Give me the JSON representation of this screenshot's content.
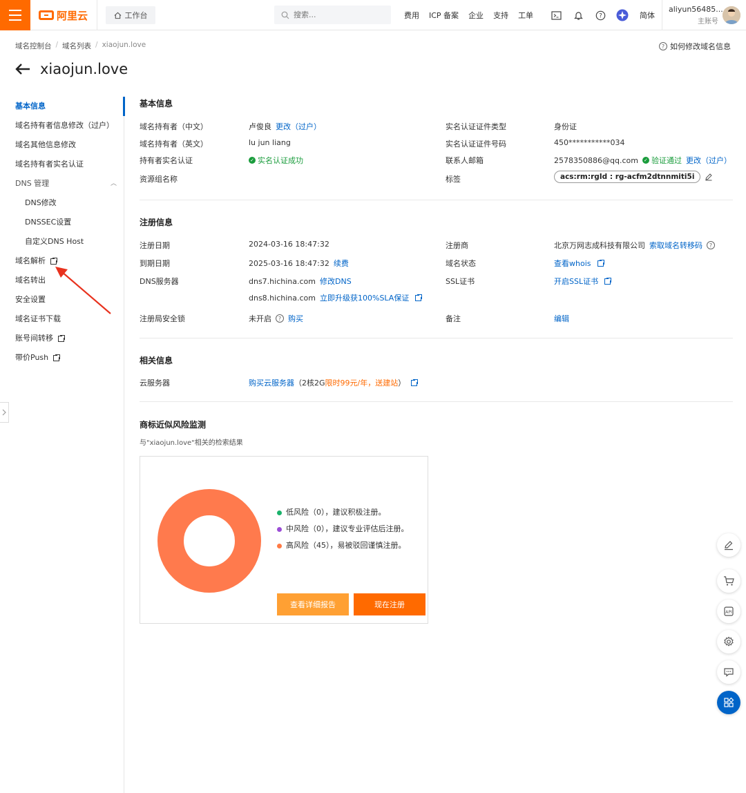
{
  "topbar": {
    "logo_text": "阿里云",
    "workbench": "工作台",
    "search_placeholder": "搜索...",
    "nav": [
      "费用",
      "ICP 备案",
      "企业",
      "支持",
      "工单"
    ],
    "lang": "简体",
    "account_name": "aliyun56485...",
    "account_role": "主账号"
  },
  "breadcrumb": [
    "域名控制台",
    "域名列表",
    "xiaojun.love"
  ],
  "help_link": "如何修改域名信息",
  "page_title": "xiaojun.love",
  "sidebar": {
    "items": [
      {
        "label": "基本信息"
      },
      {
        "label": "域名持有者信息修改（过户）"
      },
      {
        "label": "域名其他信息修改"
      },
      {
        "label": "域名持有者实名认证"
      },
      {
        "label": "DNS 管理"
      },
      {
        "label": "DNS修改"
      },
      {
        "label": "DNSSEC设置"
      },
      {
        "label": "自定义DNS Host"
      },
      {
        "label": "域名解析"
      },
      {
        "label": "域名转出"
      },
      {
        "label": "安全设置"
      },
      {
        "label": "域名证书下载"
      },
      {
        "label": "账号间转移"
      },
      {
        "label": "带价Push"
      }
    ]
  },
  "basic": {
    "title": "基本信息",
    "holder_cn_label": "域名持有者（中文）",
    "holder_cn_value": "卢俊良",
    "holder_cn_change": "更改（过户）",
    "holder_en_label": "域名持有者（英文）",
    "holder_en_value": "lu jun liang",
    "realname_label": "持有者实名认证",
    "realname_value": "实名认证成功",
    "resource_group_label": "资源组名称",
    "cert_type_label": "实名认证证件类型",
    "cert_type_value": "身份证",
    "cert_no_label": "实名认证证件号码",
    "cert_no_value": "450***********034",
    "email_label": "联系人邮箱",
    "email_value": "2578350886@qq.com",
    "email_verified": "验证通过",
    "email_change": "更改（过户）",
    "tag_label": "标签",
    "tag_value": "acs:rm:rgId : rg-acfm2dtnnmiti5i"
  },
  "registration": {
    "title": "注册信息",
    "reg_date_label": "注册日期",
    "reg_date_value": "2024-03-16 18:47:32",
    "exp_date_label": "到期日期",
    "exp_date_value": "2025-03-16 18:47:32",
    "renew": "续费",
    "dns_label": "DNS服务器",
    "dns1": "dns7.hichina.com",
    "dns_modify": "修改DNS",
    "dns2": "dns8.hichina.com",
    "dns_upgrade": "立即升级获100%SLA保证",
    "lock_label": "注册局安全锁",
    "lock_value": "未开启",
    "lock_buy": "购买",
    "registrar_label": "注册商",
    "registrar_value": "北京万网志成科技有限公司",
    "transfer_code": "索取域名转移码",
    "status_label": "域名状态",
    "status_link": "查看whois",
    "ssl_label": "SSL证书",
    "ssl_link": "开启SSL证书",
    "note_label": "备注",
    "note_edit": "编辑"
  },
  "related": {
    "title": "相关信息",
    "cloud_label": "云服务器",
    "cloud_link": "购买云服务器",
    "cloud_spec_prefix": "（2核2G",
    "cloud_promo": "限时99元/年，送建站",
    "cloud_spec_suffix": "）"
  },
  "trademark": {
    "title": "商标近似风险监测",
    "subtitle": "与\"xiaojun.love\"相关的检索结果",
    "legend": [
      {
        "text": "低风险（0），建议积极注册。",
        "color": "#1ab26b"
      },
      {
        "text": "中风险（0），建议专业评估后注册。",
        "color": "#9b4dd6"
      },
      {
        "text": "高风险（45），易被驳回谨慎注册。",
        "color": "#ff7a45"
      }
    ],
    "btn_report": "查看详细报告",
    "btn_register": "现在注册"
  },
  "chart_data": {
    "type": "pie",
    "categories": [
      "低风险",
      "中风险",
      "高风险"
    ],
    "values": [
      0,
      0,
      45
    ],
    "colors": [
      "#1ab26b",
      "#9b4dd6",
      "#ff7a4d"
    ]
  }
}
